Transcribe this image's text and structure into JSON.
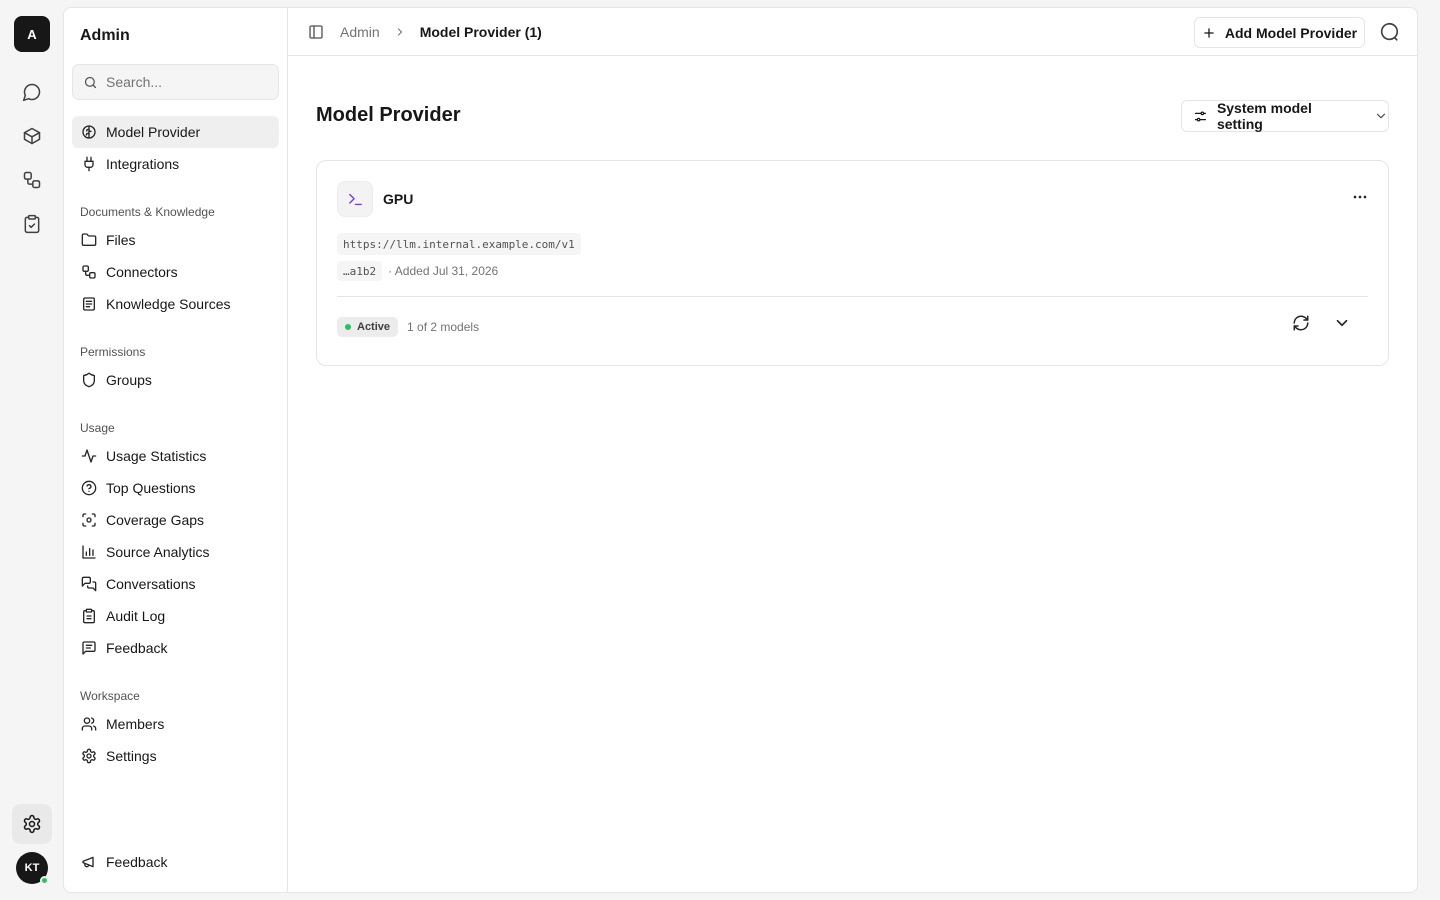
{
  "rail": {
    "logo": "A",
    "icons": [
      "chat-icon",
      "box-icon",
      "workflow-icon",
      "clipboard-check-icon",
      "settings-icon"
    ],
    "avatar": "KT"
  },
  "sidebar": {
    "title": "Admin",
    "search_placeholder": "Search...",
    "top_items": [
      {
        "label": "Model Provider",
        "icon": "brain-icon",
        "active": true
      },
      {
        "label": "Integrations",
        "icon": "plug-icon"
      }
    ],
    "groups": [
      {
        "label": "Documents & Knowledge",
        "items": [
          {
            "label": "Files",
            "icon": "folder-icon"
          },
          {
            "label": "Connectors",
            "icon": "connector-icon"
          },
          {
            "label": "Knowledge Sources",
            "icon": "book-icon"
          }
        ]
      },
      {
        "label": "Permissions",
        "items": [
          {
            "label": "Groups",
            "icon": "shield-icon"
          }
        ]
      },
      {
        "label": "Usage",
        "items": [
          {
            "label": "Usage Statistics",
            "icon": "activity-icon"
          },
          {
            "label": "Top Questions",
            "icon": "help-circle-icon"
          },
          {
            "label": "Coverage Gaps",
            "icon": "scan-icon"
          },
          {
            "label": "Source Analytics",
            "icon": "bar-chart-icon"
          },
          {
            "label": "Conversations",
            "icon": "messages-icon"
          },
          {
            "label": "Audit Log",
            "icon": "clipboard-list-icon"
          },
          {
            "label": "Feedback",
            "icon": "message-square-text-icon"
          }
        ]
      },
      {
        "label": "Workspace",
        "items": [
          {
            "label": "Members",
            "icon": "users-icon"
          },
          {
            "label": "Settings",
            "icon": "gear-icon"
          }
        ]
      }
    ],
    "bottom_item": {
      "label": "Feedback",
      "icon": "megaphone-icon"
    }
  },
  "topbar": {
    "breadcrumb_root": "Admin",
    "breadcrumb_current": "Model Provider (1)",
    "add_button": "Add Model Provider"
  },
  "main": {
    "title": "Model Provider",
    "system_button": "System model setting",
    "providers": [
      {
        "name": "GPU",
        "url": "https://llm.internal.example.com/v1",
        "key": "…a1b2",
        "added": "· Added Jul 31, 2026",
        "status": "Active",
        "models": "1 of 2 models"
      }
    ]
  }
}
